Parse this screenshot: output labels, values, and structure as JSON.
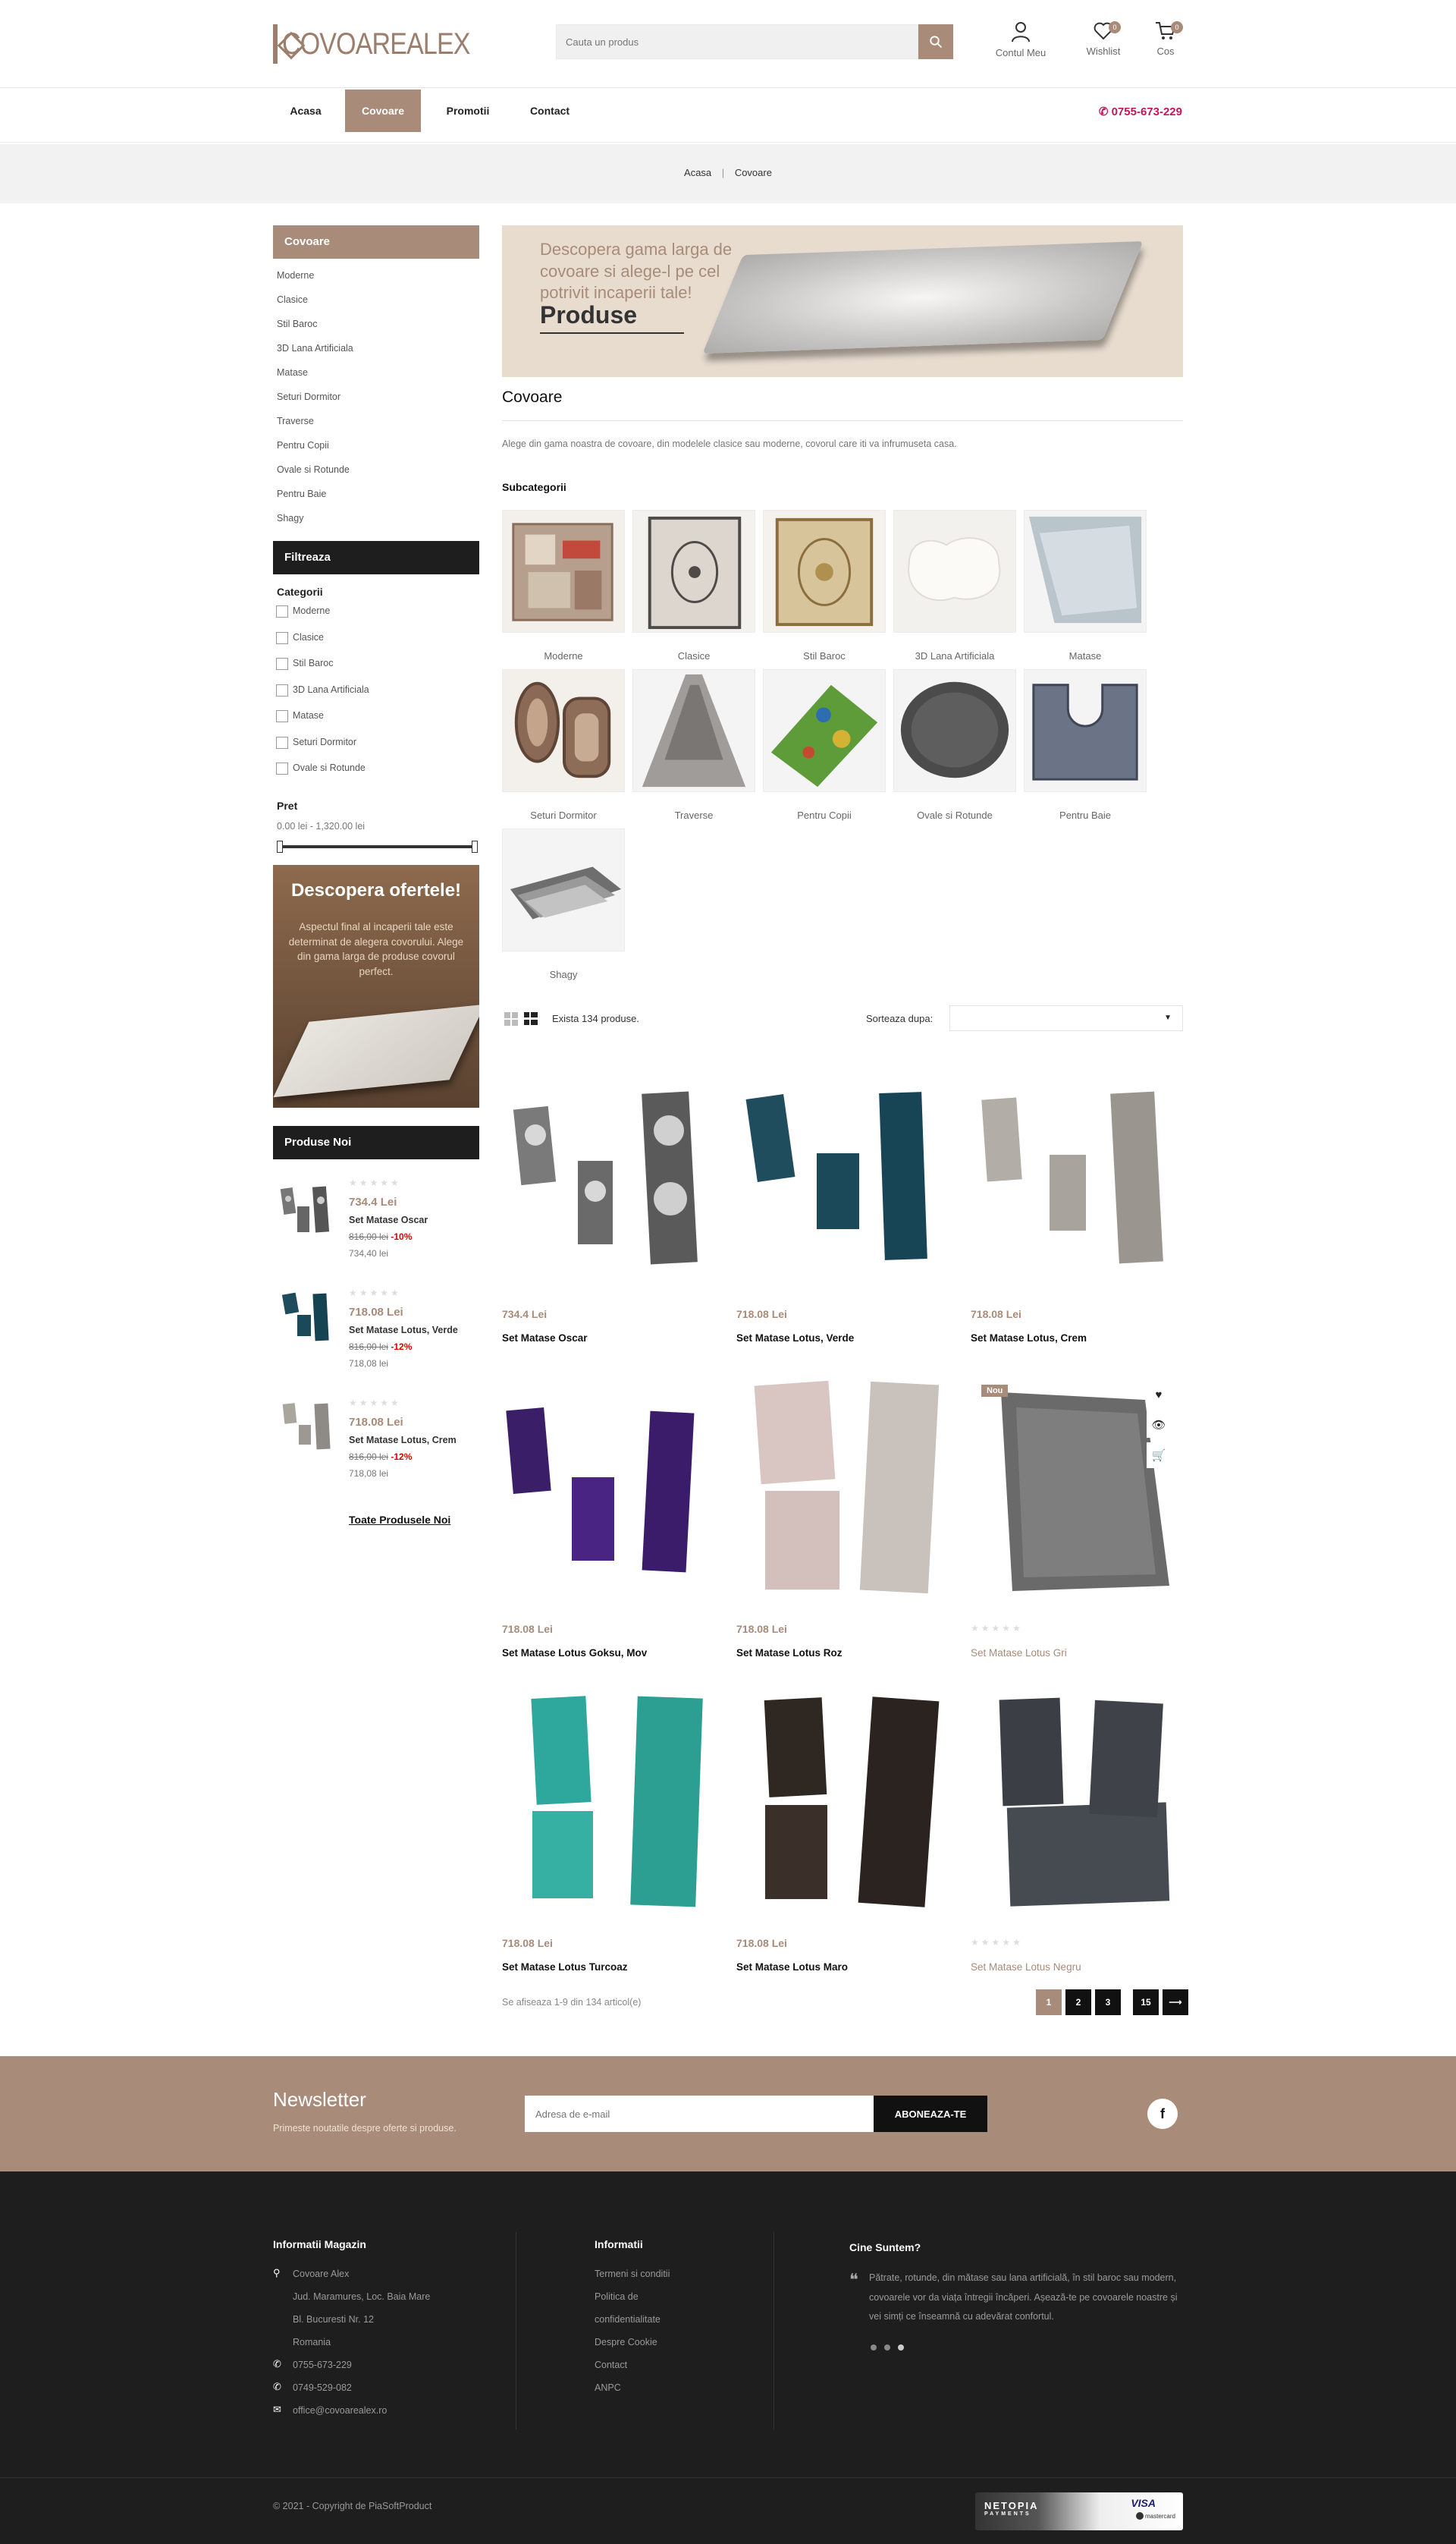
{
  "header": {
    "logo_text": "COVOAREALEX",
    "search_placeholder": "Cauta un produs",
    "account_label": "Contul Meu",
    "wishlist_label": "Wishlist",
    "wishlist_count": "0",
    "cart_label": "Cos",
    "cart_count": "0"
  },
  "nav": {
    "items": [
      {
        "label": "Acasa"
      },
      {
        "label": "Covoare"
      },
      {
        "label": "Promotii"
      },
      {
        "label": "Contact"
      }
    ],
    "active_index": 1,
    "phone": "0755-673-229"
  },
  "breadcrumb": {
    "home": "Acasa",
    "separator": "|",
    "current": "Covoare"
  },
  "sidebar": {
    "categories_title": "Covoare",
    "categories": [
      "Moderne",
      "Clasice",
      "Stil Baroc",
      "3D Lana Artificiala",
      "Matase",
      "Seturi Dormitor",
      "Traverse",
      "Pentru Copii",
      "Ovale si Rotunde",
      "Pentru Baie",
      "Shagy"
    ],
    "filter_title": "Filtreaza",
    "filter_categories_label": "Categorii",
    "filter_options": [
      "Moderne",
      "Clasice",
      "Stil Baroc",
      "3D Lana Artificiala",
      "Matase",
      "Seturi Dormitor",
      "Ovale si Rotunde"
    ],
    "price_label": "Pret",
    "price_range": "0.00 lei - 1,320.00 lei",
    "promo_title": "Descopera ofertele!",
    "promo_text": "Aspectul final al incaperii tale este determinat de alegera covorului. Alege din gama larga de produse covorul perfect.",
    "new_title": "Produse Noi",
    "new_products": [
      {
        "price": "734.4 Lei",
        "name": "Set Matase Oscar",
        "old": "816,00 lei",
        "discount": "-10%",
        "final": "734,40 lei",
        "stars": "★★★★★"
      },
      {
        "price": "718.08 Lei",
        "name": "Set Matase Lotus, Verde",
        "old": "816,00 lei",
        "discount": "-12%",
        "final": "718,08 lei",
        "stars": "★★★★★"
      },
      {
        "price": "718.08 Lei",
        "name": "Set Matase Lotus, Crem",
        "old": "816,00 lei",
        "discount": "-12%",
        "final": "718,08 lei",
        "stars": "★★★★★"
      }
    ],
    "all_new_link": "Toate Produsele Noi"
  },
  "main": {
    "banner_text": "Descopera gama larga de covoare si alege-l pe cel potrivit incaperii tale!",
    "banner_cta": "Produse",
    "title": "Covoare",
    "description": "Alege din gama noastra de covoare, din modelele clasice sau moderne, covorul care iti va infrumuseta casa.",
    "subcategories_title": "Subcategorii",
    "subcategories": [
      "Moderne",
      "Clasice",
      "Stil Baroc",
      "3D Lana Artificiala",
      "Matase",
      "Seturi Dormitor",
      "Traverse",
      "Pentru Copii",
      "Ovale si Rotunde",
      "Pentru Baie",
      "Shagy"
    ],
    "product_count": "Exista 134 produse.",
    "sort_label": "Sorteaza dupa:",
    "products": [
      {
        "price": "734.4 Lei",
        "name": "Set Matase Oscar"
      },
      {
        "price": "718.08 Lei",
        "name": "Set Matase Lotus, Verde"
      },
      {
        "price": "718.08 Lei",
        "name": "Set Matase Lotus, Crem"
      },
      {
        "price": "718.08 Lei",
        "name": "Set Matase Lotus Goksu, Mov"
      },
      {
        "price": "718.08 Lei",
        "name": "Set Matase Lotus Roz"
      },
      {
        "price": "",
        "name": "Set Matase Lotus Gri",
        "badge": "Nou",
        "stars": "★★★★★"
      },
      {
        "price": "718.08 Lei",
        "name": "Set Matase Lotus Turcoaz"
      },
      {
        "price": "718.08 Lei",
        "name": "Set Matase Lotus Maro"
      },
      {
        "price": "",
        "name": "Set Matase Lotus Negru",
        "stars": "★★★★★"
      }
    ],
    "showing_text": "Se afiseaza 1-9 din 134 articol(e)",
    "pages": [
      "1",
      "2",
      "3",
      "15"
    ],
    "next_arrow": "⟶"
  },
  "newsletter": {
    "title": "Newsletter",
    "subtitle": "Primeste noutatile despre oferte si produse.",
    "placeholder": "Adresa de e-mail",
    "button": "ABONEAZA-TE",
    "facebook": "f"
  },
  "footer": {
    "info_title": "Informatii Magazin",
    "info_lines": [
      "Covoare Alex",
      "Jud. Maramures, Loc. Baia Mare",
      "Bl. Bucuresti Nr. 12",
      "Romania"
    ],
    "phone1": "0755-673-229",
    "phone2": "0749-529-082",
    "email": "office@covoarealex.ro",
    "links_title": "Informatii",
    "links": [
      "Termeni si conditii",
      "Politica de",
      "confidentialitate",
      "Despre Cookie",
      "Contact",
      "ANPC"
    ],
    "about_title": "Cine Suntem?",
    "about_text": "Pătrate, rotunde, din mătase sau lana artificială, în stil baroc sau modern, covoarele vor da viața întregii încăperi. Așează-te pe covoarele noastre și vei simți ce înseamnă cu adevărat confortul.",
    "copyright": "© 2021 - Copyright de PiaSoftProduct",
    "payment_brand": "NETOPIA",
    "payment_sub": "PAYMENTS",
    "visa": "VISA",
    "mastercard": "mastercard"
  },
  "colors": {
    "accent": "#a88b79",
    "dark": "#1e1e1e",
    "phone": "#c2185b"
  }
}
